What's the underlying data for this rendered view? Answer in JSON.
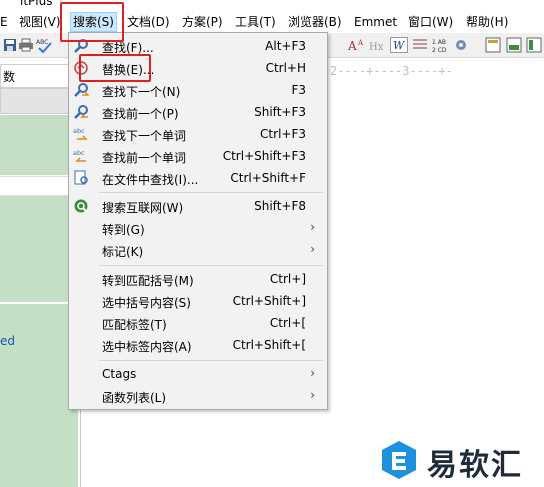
{
  "window": {
    "title_fragment": "itPlus"
  },
  "menubar": {
    "items": [
      "视图(V)",
      "搜索(S)",
      "文档(D)",
      "方案(P)",
      "工具(T)",
      "浏览器(B)",
      "Emmet",
      "窗口(W)",
      "帮助(H)"
    ],
    "active_index": 1
  },
  "left_pane": {
    "tab_label": "数",
    "link_fragment": "ed"
  },
  "search_menu": {
    "items": [
      {
        "label": "查找(F)...",
        "shortcut": "Alt+F3",
        "icon": "find-icon"
      },
      {
        "label": "替换(E)...",
        "shortcut": "Ctrl+H",
        "icon": "replace-icon"
      },
      {
        "label": "查找下一个(N)",
        "shortcut": "F3",
        "icon": "find-next-icon"
      },
      {
        "label": "查找前一个(P)",
        "shortcut": "Shift+F3",
        "icon": "find-prev-icon"
      },
      {
        "label": "查找下一个单词",
        "shortcut": "Ctrl+F3",
        "icon": "find-next-word-icon"
      },
      {
        "label": "查找前一个单词",
        "shortcut": "Ctrl+Shift+F3",
        "icon": "find-prev-word-icon"
      },
      {
        "label": "在文件中查找(I)...",
        "shortcut": "Ctrl+Shift+F",
        "icon": "find-in-files-icon"
      },
      {
        "label": "搜索互联网(W)",
        "shortcut": "Shift+F8",
        "icon": "web-search-icon"
      },
      {
        "label": "转到(G)",
        "shortcut": "",
        "submenu": true
      },
      {
        "label": "标记(K)",
        "shortcut": "",
        "submenu": true
      },
      {
        "label": "转到匹配括号(M)",
        "shortcut": "Ctrl+]"
      },
      {
        "label": "选中括号内容(S)",
        "shortcut": "Ctrl+Shift+]"
      },
      {
        "label": "匹配标签(T)",
        "shortcut": "Ctrl+["
      },
      {
        "label": "选中标签内容(A)",
        "shortcut": "Ctrl+Shift+["
      },
      {
        "label": "Ctags",
        "shortcut": "",
        "submenu": true
      },
      {
        "label": "函数列表(L)",
        "shortcut": "",
        "submenu": true
      }
    ]
  },
  "editor": {
    "ruler": "2----+----3----+-"
  },
  "watermark": {
    "text": "易软汇"
  },
  "colors": {
    "annotation_red": "#e02020",
    "menu_active": "#cce8ff",
    "pane_green": "#c5dfc7"
  }
}
